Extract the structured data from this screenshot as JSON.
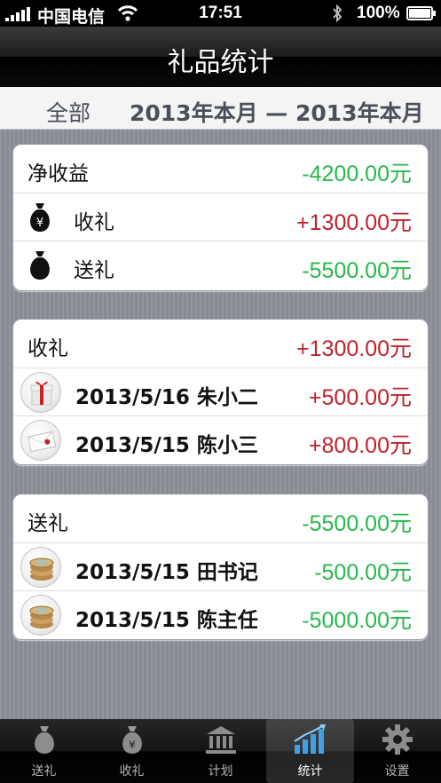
{
  "status_bar": {
    "carrier": "中国电信",
    "time": "17:51",
    "battery": "100%"
  },
  "nav": {
    "title": "礼品统计"
  },
  "filter": {
    "scope": "全部",
    "range": "2013年本月 — 2013年本月"
  },
  "summary": {
    "net_label": "净收益",
    "net_value": "-4200.00元",
    "received_label": "收礼",
    "received_value": "+1300.00元",
    "given_label": "送礼",
    "given_value": "-5500.00元"
  },
  "received": {
    "header_label": "收礼",
    "header_value": "+1300.00元",
    "items": [
      {
        "date": "2013/5/16",
        "name": "朱小二",
        "amount": "+500.00元",
        "icon": "gift-box-icon"
      },
      {
        "date": "2013/5/15",
        "name": "陈小三",
        "amount": "+800.00元",
        "icon": "envelope-icon"
      }
    ]
  },
  "given": {
    "header_label": "送礼",
    "header_value": "-5500.00元",
    "items": [
      {
        "date": "2013/5/15",
        "name": "田书记",
        "amount": "-500.00元",
        "icon": "coin-stack-icon"
      },
      {
        "date": "2013/5/15",
        "name": "陈主任",
        "amount": "-5000.00元",
        "icon": "coin-stack-icon"
      }
    ]
  },
  "tabs": [
    {
      "label": "送礼",
      "icon": "money-bag-icon",
      "active": false
    },
    {
      "label": "收礼",
      "icon": "yen-bag-icon",
      "active": false
    },
    {
      "label": "计划",
      "icon": "bank-icon",
      "active": false
    },
    {
      "label": "统计",
      "icon": "bar-chart-icon",
      "active": true
    },
    {
      "label": "设置",
      "icon": "gear-icon",
      "active": false
    }
  ],
  "colors": {
    "positive": "#c0212a",
    "negative": "#27b84a"
  }
}
